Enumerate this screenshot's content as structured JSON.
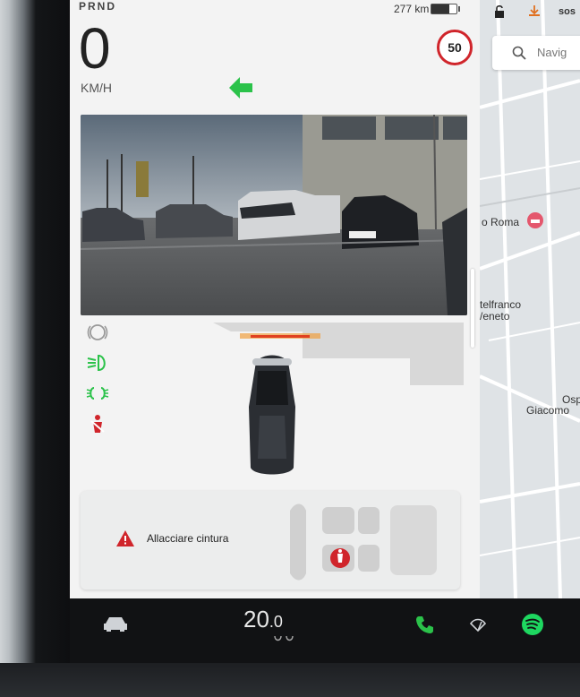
{
  "status": {
    "gear": "PRND",
    "range": "277 km",
    "sos": "sos",
    "battery_level": 0.7
  },
  "drive": {
    "speed": "0",
    "unit": "KM/H",
    "speed_limit": "50"
  },
  "alert": {
    "message": "Allacciare cintura"
  },
  "map": {
    "search_placeholder": "Navig",
    "labels": {
      "roma": "o Roma",
      "castelfranco_1": "telfranco",
      "castelfranco_2": "/eneto",
      "osp": "Osp",
      "giacomo": "Giacomo"
    }
  },
  "dock": {
    "temperature_main": "20",
    "temperature_decimal": ".0"
  },
  "colors": {
    "green": "#2bc24a",
    "red": "#d0252b",
    "spotify": "#1ed760"
  }
}
